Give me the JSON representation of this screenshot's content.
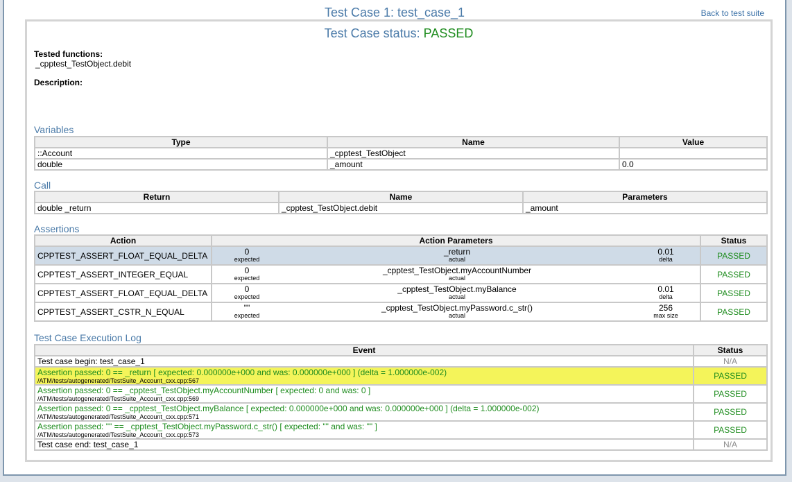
{
  "header": {
    "title": "Test Case 1: test_case_1",
    "back_link": "Back to test suite"
  },
  "status": {
    "label": "Test Case status: ",
    "value": "PASSED"
  },
  "tested_functions": {
    "label": "Tested functions:",
    "value": "_cpptest_TestObject.debit"
  },
  "description": {
    "label": "Description:"
  },
  "variables": {
    "title": "Variables",
    "headers": [
      "Type",
      "Name",
      "Value"
    ],
    "rows": [
      [
        "::Account",
        "_cpptest_TestObject",
        ""
      ],
      [
        "double",
        "_amount",
        "0.0"
      ]
    ]
  },
  "call": {
    "title": "Call",
    "headers": [
      "Return",
      "Name",
      "Parameters"
    ],
    "rows": [
      [
        "double _return",
        "_cpptest_TestObject.debit",
        "_amount"
      ]
    ]
  },
  "assertions": {
    "title": "Assertions",
    "headers": [
      "Action",
      "Action Parameters",
      "Status"
    ],
    "rows": [
      {
        "action": "CPPTEST_ASSERT_FLOAT_EQUAL_DELTA",
        "expected": "0",
        "expected_sub": "expected",
        "actual": "_return",
        "actual_sub": "actual",
        "extra": "0.01",
        "extra_sub": "delta",
        "status": "PASSED"
      },
      {
        "action": "CPPTEST_ASSERT_INTEGER_EQUAL",
        "expected": "0",
        "expected_sub": "expected",
        "actual": "_cpptest_TestObject.myAccountNumber",
        "actual_sub": "actual",
        "extra": "",
        "extra_sub": "",
        "status": "PASSED"
      },
      {
        "action": "CPPTEST_ASSERT_FLOAT_EQUAL_DELTA",
        "expected": "0",
        "expected_sub": "expected",
        "actual": "_cpptest_TestObject.myBalance",
        "actual_sub": "actual",
        "extra": "0.01",
        "extra_sub": "delta",
        "status": "PASSED"
      },
      {
        "action": "CPPTEST_ASSERT_CSTR_N_EQUAL",
        "expected": "\"\"",
        "expected_sub": "expected",
        "actual": "_cpptest_TestObject.myPassword.c_str()",
        "actual_sub": "actual",
        "extra": "256",
        "extra_sub": "max size",
        "status": "PASSED"
      }
    ]
  },
  "log": {
    "title": "Test Case Execution Log",
    "headers": [
      "Event",
      "Status"
    ],
    "rows": [
      {
        "event": "Test case begin: test_case_1",
        "path": "",
        "status": "N/A"
      },
      {
        "event": "Assertion passed: 0 == _return [ expected: 0.000000e+000 and was: 0.000000e+000 ] (delta = 1.000000e-002)",
        "path": "/ATM/tests/autogenerated/TestSuite_Account_cxx.cpp:567",
        "status": "PASSED"
      },
      {
        "event": "Assertion passed: 0 == _cpptest_TestObject.myAccountNumber [ expected: 0 and was: 0 ]",
        "path": "/ATM/tests/autogenerated/TestSuite_Account_cxx.cpp:569",
        "status": "PASSED"
      },
      {
        "event": "Assertion passed: 0 == _cpptest_TestObject.myBalance [ expected: 0.000000e+000 and was: 0.000000e+000 ] (delta = 1.000000e-002)",
        "path": "/ATM/tests/autogenerated/TestSuite_Account_cxx.cpp:571",
        "status": "PASSED"
      },
      {
        "event": "Assertion passed: \"\" == _cpptest_TestObject.myPassword.c_str() [ expected: \"\" and was: \"\" ]",
        "path": "/ATM/tests/autogenerated/TestSuite_Account_cxx.cpp:573",
        "status": "PASSED"
      },
      {
        "event": "Test case end: test_case_1",
        "path": "",
        "status": "N/A"
      }
    ]
  },
  "colors": {
    "accent": "#4a7aa8",
    "passed": "#1e8c1e",
    "highlight_blue": "#cfdbe7",
    "highlight_yellow": "#f4f45a",
    "na": "#8c8c8c"
  }
}
